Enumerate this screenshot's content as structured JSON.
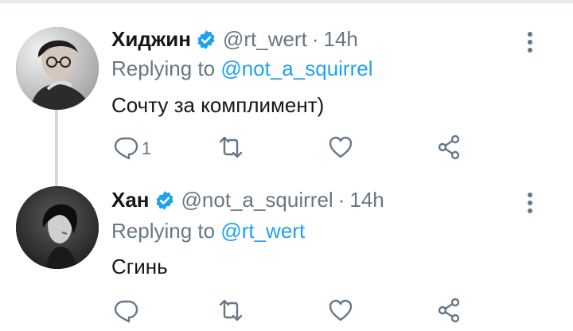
{
  "tweets": [
    {
      "name": "Хиджин",
      "handle": "@rt_wert",
      "separator": "·",
      "time": "14h",
      "replying_prefix": "Replying to",
      "replying_to": "@not_a_squirrel",
      "text": "Сочту за комплимент)",
      "reply_count": "1",
      "avatar": "person-with-glasses-avatar"
    },
    {
      "name": "Хан",
      "handle": "@not_a_squirrel",
      "separator": "·",
      "time": "14h",
      "replying_prefix": "Replying to",
      "replying_to": "@rt_wert",
      "text": "Сгинь",
      "reply_count": "",
      "avatar": "dark-portrait-avatar"
    }
  ],
  "icons": {
    "verified": "verified-badge-icon",
    "reply": "reply-icon",
    "retweet": "retweet-icon",
    "like": "heart-icon",
    "share": "share-icon",
    "more": "more-vertical-icon"
  },
  "colors": {
    "accent": "#1da1f2",
    "secondary_text": "#657786",
    "primary_text": "#14171a",
    "thread_line": "#cfd9de"
  }
}
